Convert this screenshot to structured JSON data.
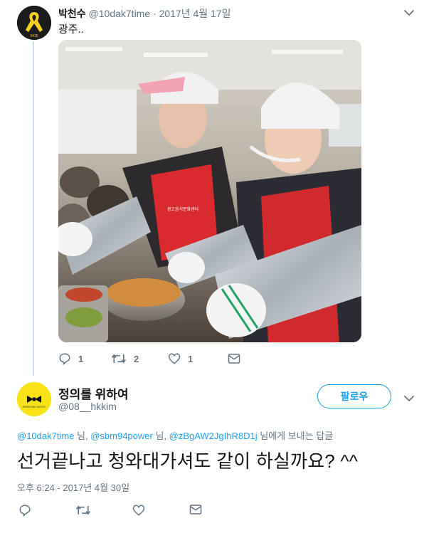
{
  "parent_tweet": {
    "name": "박천수",
    "handle": "@10dak7time",
    "separator": "·",
    "date": "2017년 4월 17일",
    "text": "광주..",
    "avatar_text": "0416",
    "actions": {
      "reply_count": "1",
      "retweet_count": "2",
      "like_count": "1"
    },
    "photo_apron_text": "광고음식문화센터"
  },
  "reply_tweet": {
    "name": "정의를 위하여",
    "handle": "@08__hkkim",
    "avatar_text": "SEARCHING JUSTICE",
    "follow_label": "팔로우",
    "reply_to": {
      "mention1": "@10dak7time",
      "sep1": " 님, ",
      "mention2": "@sbm94power",
      "sep2": " 님, ",
      "mention3": "@zBgAW2JgIhR8D1j",
      "suffix": " 님에게 보내는 답글"
    },
    "text": "선거끝나고 청와대가셔도 같이 하실까요? ^^",
    "timestamp": "오후 6:24 - 2017년 4월 30일"
  },
  "colors": {
    "accent": "#1da1f2",
    "muted": "#657786",
    "thread_line": "#c4e3f5",
    "ribbon": "#f7d11e",
    "avatar2_bg": "#f7e316"
  },
  "icons": [
    "yellow-ribbon-icon",
    "chevron-down-icon",
    "reply-icon",
    "retweet-icon",
    "like-icon",
    "message-icon",
    "bow-tie-icon"
  ]
}
